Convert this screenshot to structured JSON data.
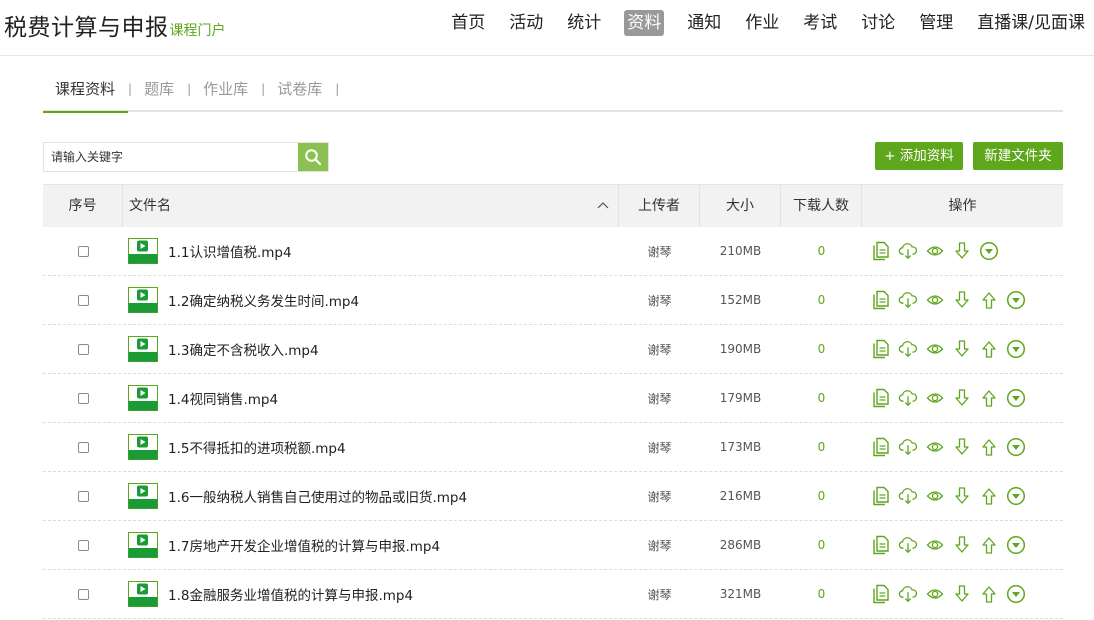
{
  "brand": {
    "title": "税费计算与申报",
    "subtitle": "课程门户"
  },
  "nav": [
    "首页",
    "活动",
    "统计",
    "资料",
    "通知",
    "作业",
    "考试",
    "讨论",
    "管理",
    "直播课/见面课"
  ],
  "nav_active": "资料",
  "subtabs": [
    "课程资料",
    "题库",
    "作业库",
    "试卷库"
  ],
  "subtab_active": "课程资料",
  "search": {
    "placeholder": "请输入关键字",
    "value": ""
  },
  "buttons": {
    "add": "+ 添加资料",
    "new_folder": "新建文件夹"
  },
  "table": {
    "headers": {
      "index": "序号",
      "name": "文件名",
      "uploader": "上传者",
      "size": "大小",
      "downloads": "下载人数",
      "actions": "操作"
    },
    "rows": [
      {
        "name": "1.1认识增值税.mp4",
        "uploader": "谢琴",
        "size": "210MB",
        "downloads": "0"
      },
      {
        "name": "1.2确定纳税义务发生时间.mp4",
        "uploader": "谢琴",
        "size": "152MB",
        "downloads": "0"
      },
      {
        "name": "1.3确定不含税收入.mp4",
        "uploader": "谢琴",
        "size": "190MB",
        "downloads": "0"
      },
      {
        "name": "1.4视同销售.mp4",
        "uploader": "谢琴",
        "size": "179MB",
        "downloads": "0"
      },
      {
        "name": "1.5不得抵扣的进项税额.mp4",
        "uploader": "谢琴",
        "size": "173MB",
        "downloads": "0"
      },
      {
        "name": "1.6一般纳税人销售自己使用过的物品或旧货.mp4",
        "uploader": "谢琴",
        "size": "216MB",
        "downloads": "0"
      },
      {
        "name": "1.7房地产开发企业增值税的计算与申报.mp4",
        "uploader": "谢琴",
        "size": "286MB",
        "downloads": "0"
      },
      {
        "name": "1.8金融服务业增值税的计算与申报.mp4",
        "uploader": "谢琴",
        "size": "321MB",
        "downloads": "0"
      }
    ]
  },
  "colors": {
    "accent": "#5ea61b",
    "search_button": "#8cc152",
    "nav_active_bg": "#999999"
  },
  "icons": {
    "file": "video-file-icon",
    "actions": [
      "document-icon",
      "cloud-download-icon",
      "preview-eye-icon",
      "move-down-icon",
      "move-up-icon",
      "more-circle-icon"
    ]
  }
}
